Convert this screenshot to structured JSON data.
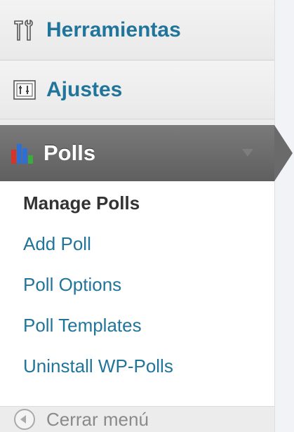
{
  "sidebar": {
    "items": [
      {
        "label": "Herramientas",
        "icon": "tools-icon"
      },
      {
        "label": "Ajustes",
        "icon": "settings-icon"
      }
    ],
    "active": {
      "label": "Polls",
      "icon": "bar-chart-icon"
    },
    "submenu": [
      {
        "label": "Manage Polls",
        "current": true
      },
      {
        "label": "Add Poll",
        "current": false
      },
      {
        "label": "Poll Options",
        "current": false
      },
      {
        "label": "Poll Templates",
        "current": false
      },
      {
        "label": "Uninstall WP-Polls",
        "current": false
      }
    ],
    "collapse_label": "Cerrar menú"
  },
  "colors": {
    "link": "#21759b",
    "active_bg": "#6a6a6a",
    "current_text": "#333333",
    "muted": "#8a8a8a"
  }
}
